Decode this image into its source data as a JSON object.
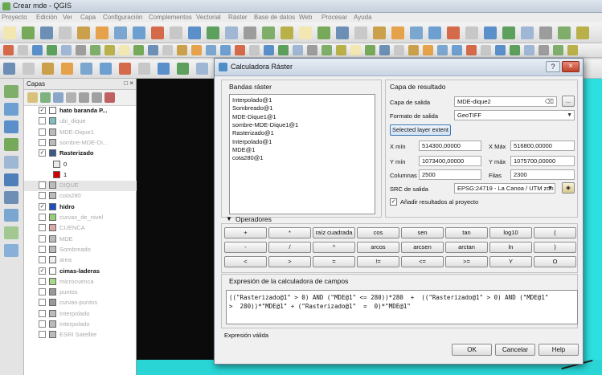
{
  "window": {
    "title": "Crear mde - QGIS"
  },
  "menubar": [
    "Proyecto",
    "Edición",
    "Ver",
    "Capa",
    "Configuración",
    "Complementos",
    "Vectorial",
    "Ráster",
    "Base de datos",
    "Web",
    "Procesar",
    "Ayuda"
  ],
  "layers_panel": {
    "title": "Capas",
    "buttons": "□ ×",
    "layers": [
      {
        "name": "hato baranda P...",
        "checked": true,
        "style": "bold",
        "symbol_color": "#ffffff",
        "indent": 0
      },
      {
        "name": "ubi_dique",
        "checked": false,
        "style": "dim",
        "symbol_color": "#7fbfbf",
        "indent": 0
      },
      {
        "name": "MDE-Dique1",
        "checked": false,
        "style": "dim",
        "symbol_color": "#bbbbbb",
        "indent": 0
      },
      {
        "name": "sombre-MDE-Di...",
        "checked": false,
        "style": "dim",
        "symbol_color": "#bbbbbb",
        "indent": 0
      },
      {
        "name": "Rasterizado",
        "checked": true,
        "style": "bold",
        "symbol_color": "#3a5a8a",
        "indent": 0
      },
      {
        "name": "0",
        "checked": null,
        "style": "normal",
        "symbol_color": "#eaeaea",
        "indent": 1
      },
      {
        "name": "1",
        "checked": null,
        "style": "normal",
        "symbol_color": "#d40000",
        "indent": 1
      },
      {
        "name": "DIQUE",
        "checked": false,
        "style": "dim",
        "symbol_color": "#bbbbbb",
        "indent": 0,
        "selected": true
      },
      {
        "name": "cota280",
        "checked": false,
        "style": "dim",
        "symbol_color": "#bbbbbb",
        "indent": 0
      },
      {
        "name": "hidro",
        "checked": true,
        "style": "bold",
        "symbol_color": "#1f4fbf",
        "indent": 0
      },
      {
        "name": "curvas_de_nivel",
        "checked": false,
        "style": "dim",
        "symbol_color": "#9acd7a",
        "indent": 0
      },
      {
        "name": "CUENCA",
        "checked": false,
        "style": "dim",
        "symbol_color": "#d9a8a8",
        "indent": 0
      },
      {
        "name": "MDE",
        "checked": false,
        "style": "dim",
        "symbol_color": "#bbbbbb",
        "indent": 0
      },
      {
        "name": "Sombreado",
        "checked": false,
        "style": "dim",
        "symbol_color": "#bbbbbb",
        "indent": 0
      },
      {
        "name": "area",
        "checked": false,
        "style": "dim",
        "symbol_color": "#eeeeee",
        "indent": 0
      },
      {
        "name": "cimas-laderas",
        "checked": true,
        "style": "bold",
        "symbol_color": "#ffffff",
        "indent": 0
      },
      {
        "name": "microcuenca",
        "checked": false,
        "style": "dim",
        "symbol_color": "#a8d88a",
        "indent": 0
      },
      {
        "name": "puntos",
        "checked": false,
        "style": "dim",
        "symbol_color": "#999999",
        "indent": 0
      },
      {
        "name": "curvas-puntos",
        "checked": false,
        "style": "dim",
        "symbol_color": "#999999",
        "indent": 0
      },
      {
        "name": "Interpolado",
        "checked": false,
        "style": "dim",
        "symbol_color": "#bbbbbb",
        "indent": 0
      },
      {
        "name": "Interpolado",
        "checked": false,
        "style": "dim",
        "symbol_color": "#bbbbbb",
        "indent": 0
      },
      {
        "name": "ESRI Satellite",
        "checked": false,
        "style": "dim",
        "symbol_color": "#bbbbbb",
        "indent": 0
      }
    ]
  },
  "dialog": {
    "title": "Calculadora Ráster",
    "help_icon": "?",
    "close_icon": "×",
    "bands": {
      "title": "Bandas ráster",
      "items": [
        "Interpolado@1",
        "Sombreado@1",
        "MDE-Dique1@1",
        "sombre-MDE-Dique1@1",
        "Rasterizado@1",
        "Interpolado@1",
        "MDE@1",
        "cota280@1"
      ]
    },
    "result": {
      "title": "Capa de resultado",
      "output_layer_label": "Capa de salida",
      "output_layer_value": "MDE-dique2",
      "browse_label": "...",
      "format_label": "Formato de salida",
      "format_value": "GeoTIFF",
      "extent_button": "Selected layer extent",
      "xmin_label": "X mín",
      "xmin_value": "514300,00000",
      "xmax_label": "X Máx",
      "xmax_value": "516800,00000",
      "ymin_label": "Y mín",
      "ymin_value": "1073400,00000",
      "ymax_label": "Y máx",
      "ymax_value": "1075700,00000",
      "columns_label": "Columnas",
      "columns_value": "2500",
      "rows_label": "Filas",
      "rows_value": "2300",
      "crs_label": "SRC de salida",
      "crs_value": "EPSG:24719 - La Canoa / UTM zon",
      "add_to_project_label": "Añadir resultados al proyecto",
      "add_to_project_checked": true
    },
    "operators": {
      "title": "Operadores",
      "rows": [
        [
          "+",
          "*",
          "raíz cuadrada",
          "cos",
          "sen",
          "tan",
          "log10",
          "("
        ],
        [
          "-",
          "/",
          "^",
          "arcos",
          "arcsen",
          "arctan",
          "ln",
          ")"
        ],
        [
          "<",
          ">",
          "=",
          "!=",
          "<=",
          ">=",
          "Y",
          "O"
        ]
      ]
    },
    "expression": {
      "title": "Expresión de la calculadora de campos",
      "text": "((\"Rasterizado@1\" > 0) AND (\"MDE@1\" <= 280))*280  +  ((\"Rasterizado@1\" > 0) AND (\"MDE@1\"\n>  280))*\"MDE@1\" + (\"Rasterizado@1\"  =  0)*\"MDE@1\"",
      "status": "Expresión válida"
    },
    "footer": {
      "ok": "OK",
      "cancel": "Cancelar",
      "help": "Help"
    }
  },
  "colors": {
    "map_background": "#2de0e0",
    "map_dark": "#0b0b0b",
    "dialog_bg": "#f0f0f0",
    "close_button": "#c0422b"
  }
}
